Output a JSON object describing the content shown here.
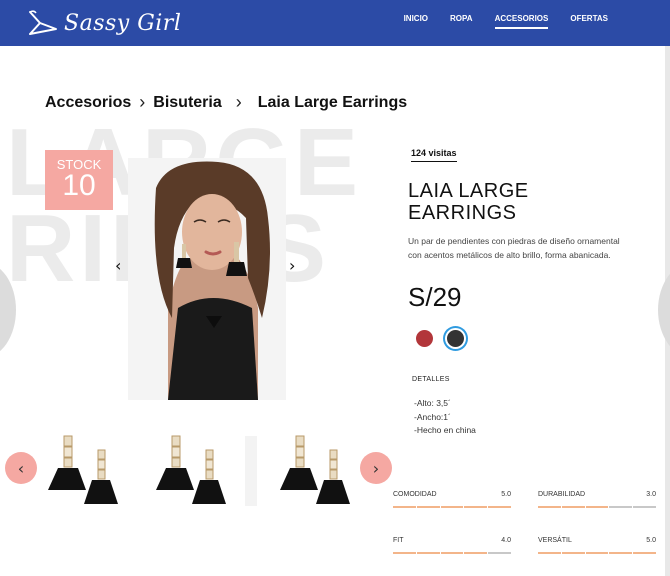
{
  "header": {
    "logo_text": "Sassy Girl",
    "nav": [
      {
        "label": "INICIO",
        "active": false
      },
      {
        "label": "ROPA",
        "active": false
      },
      {
        "label": "ACCESORIOS",
        "active": true
      },
      {
        "label": "OFERTAS",
        "active": false
      }
    ]
  },
  "breadcrumb": {
    "level1": "Accesorios",
    "level2": "Bisuteria",
    "current": "Laia Large Earrings"
  },
  "watermark": "LARGE\nRINGS",
  "stock": {
    "label": "STOCK",
    "value": "10"
  },
  "product": {
    "visits": "124 visitas",
    "title": "LAIA LARGE EARRINGS",
    "description": "Un par de pendientes con piedras de diseño ornamental con acentos metálicos de alto brillo, forma abanicada.",
    "price": "S/29",
    "colors": [
      "#b2363a",
      "#333333"
    ],
    "selected_color": "#333333",
    "details_title": "DETALLES",
    "details": [
      "-Alto: 3,5´",
      "-Ancho:1´",
      "-Hecho en china"
    ]
  },
  "ratings": [
    {
      "label": "COMODIDAD",
      "value": "5.0",
      "score": 5
    },
    {
      "label": "DURABILIDAD",
      "value": "3.0",
      "score": 3
    },
    {
      "label": "FIT",
      "value": "4.0",
      "score": 4
    },
    {
      "label": "VERSÁTIL",
      "value": "5.0",
      "score": 5
    }
  ],
  "colors": {
    "header": "#2c4ba6",
    "accent_pink": "#f5a8a2",
    "rating_bar": "#f3b58a"
  }
}
